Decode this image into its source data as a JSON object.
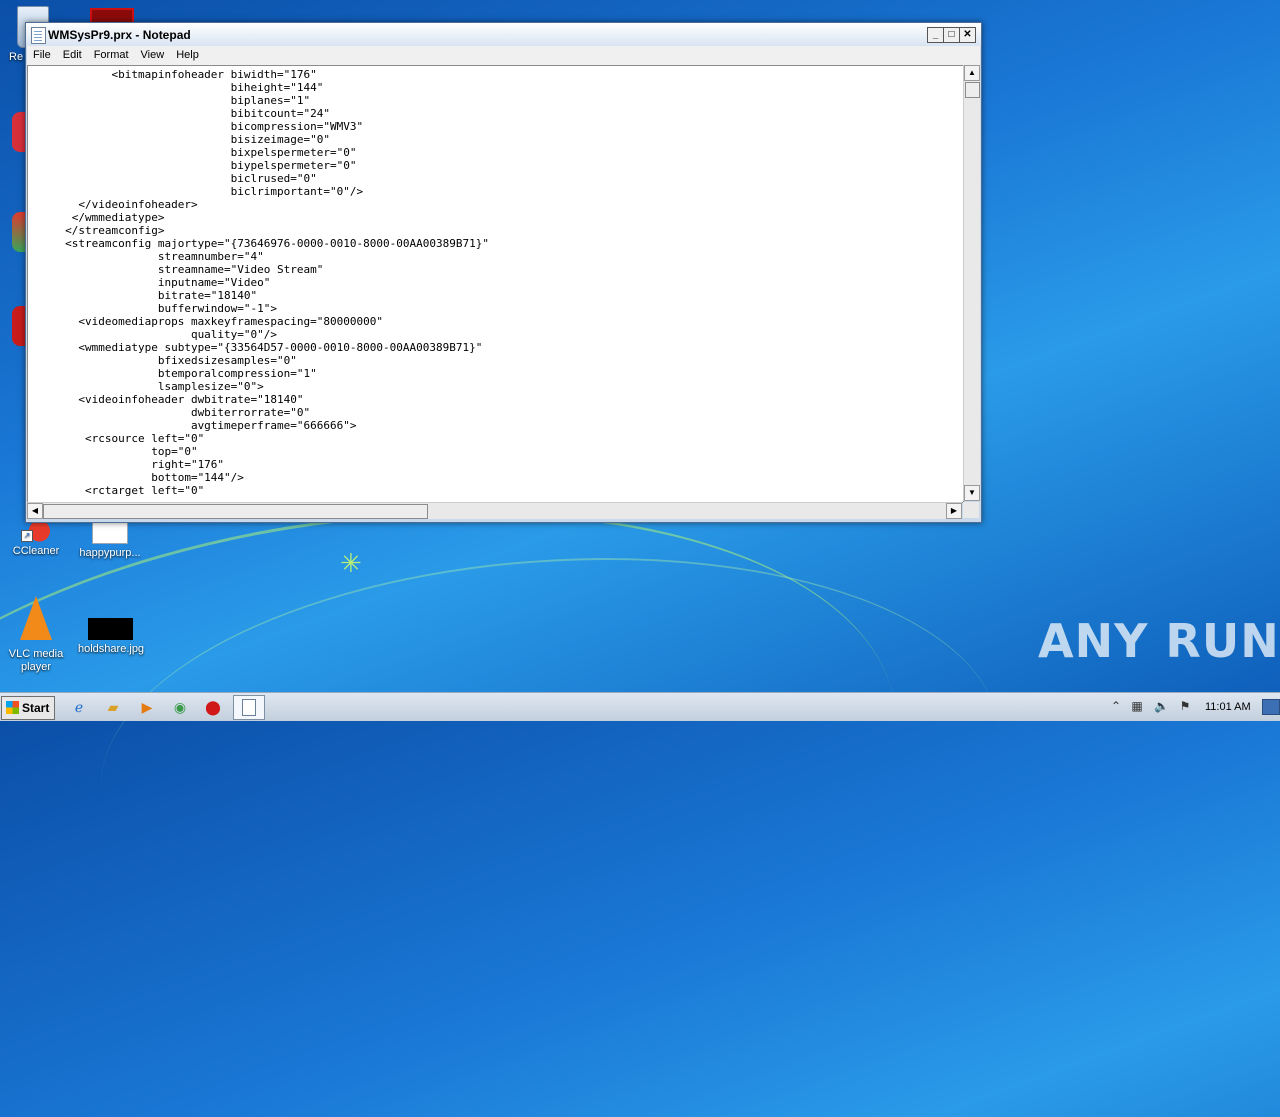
{
  "desktop": {
    "icons": [
      {
        "label": "Re",
        "name": "recycle-bin"
      },
      {
        "label": "CCleaner",
        "name": "ccleaner"
      },
      {
        "label": "happypurp...",
        "name": "happypurp-file"
      },
      {
        "label": "VLC media player",
        "name": "vlc-media-player"
      },
      {
        "label": "holdshare.jpg",
        "name": "holdshare-jpg"
      }
    ],
    "watermark": "ANY RUN"
  },
  "notepad": {
    "title": "WMSysPr9.prx - Notepad",
    "menu": [
      "File",
      "Edit",
      "Format",
      "View",
      "Help"
    ],
    "content": "            <bitmapinfoheader biwidth=\"176\"\n                              biheight=\"144\"\n                              biplanes=\"1\"\n                              bibitcount=\"24\"\n                              bicompression=\"WMV3\"\n                              bisizeimage=\"0\"\n                              bixpelspermeter=\"0\"\n                              biypelspermeter=\"0\"\n                              biclrused=\"0\"\n                              biclrimportant=\"0\"/>\n       </videoinfoheader>\n      </wmmediatype>\n     </streamconfig>\n     <streamconfig majortype=\"{73646976-0000-0010-8000-00AA00389B71}\"\n                   streamnumber=\"4\"\n                   streamname=\"Video Stream\"\n                   inputname=\"Video\"\n                   bitrate=\"18140\"\n                   bufferwindow=\"-1\">\n       <videomediaprops maxkeyframespacing=\"80000000\"\n                        quality=\"0\"/>\n       <wmmediatype subtype=\"{33564D57-0000-0010-8000-00AA00389B71}\"\n                   bfixedsizesamples=\"0\"\n                   btemporalcompression=\"1\"\n                   lsamplesize=\"0\">\n       <videoinfoheader dwbitrate=\"18140\"\n                        dwbiterrorrate=\"0\"\n                        avgtimeperframe=\"666666\">\n        <rcsource left=\"0\"\n                  top=\"0\"\n                  right=\"176\"\n                  bottom=\"144\"/>\n        <rctarget left=\"0\""
  },
  "taskbar": {
    "start_label": "Start",
    "clock": "11:01 AM",
    "pinned": [
      "internet-explorer",
      "explorer",
      "media-player",
      "chrome",
      "opera",
      "notepad"
    ]
  }
}
